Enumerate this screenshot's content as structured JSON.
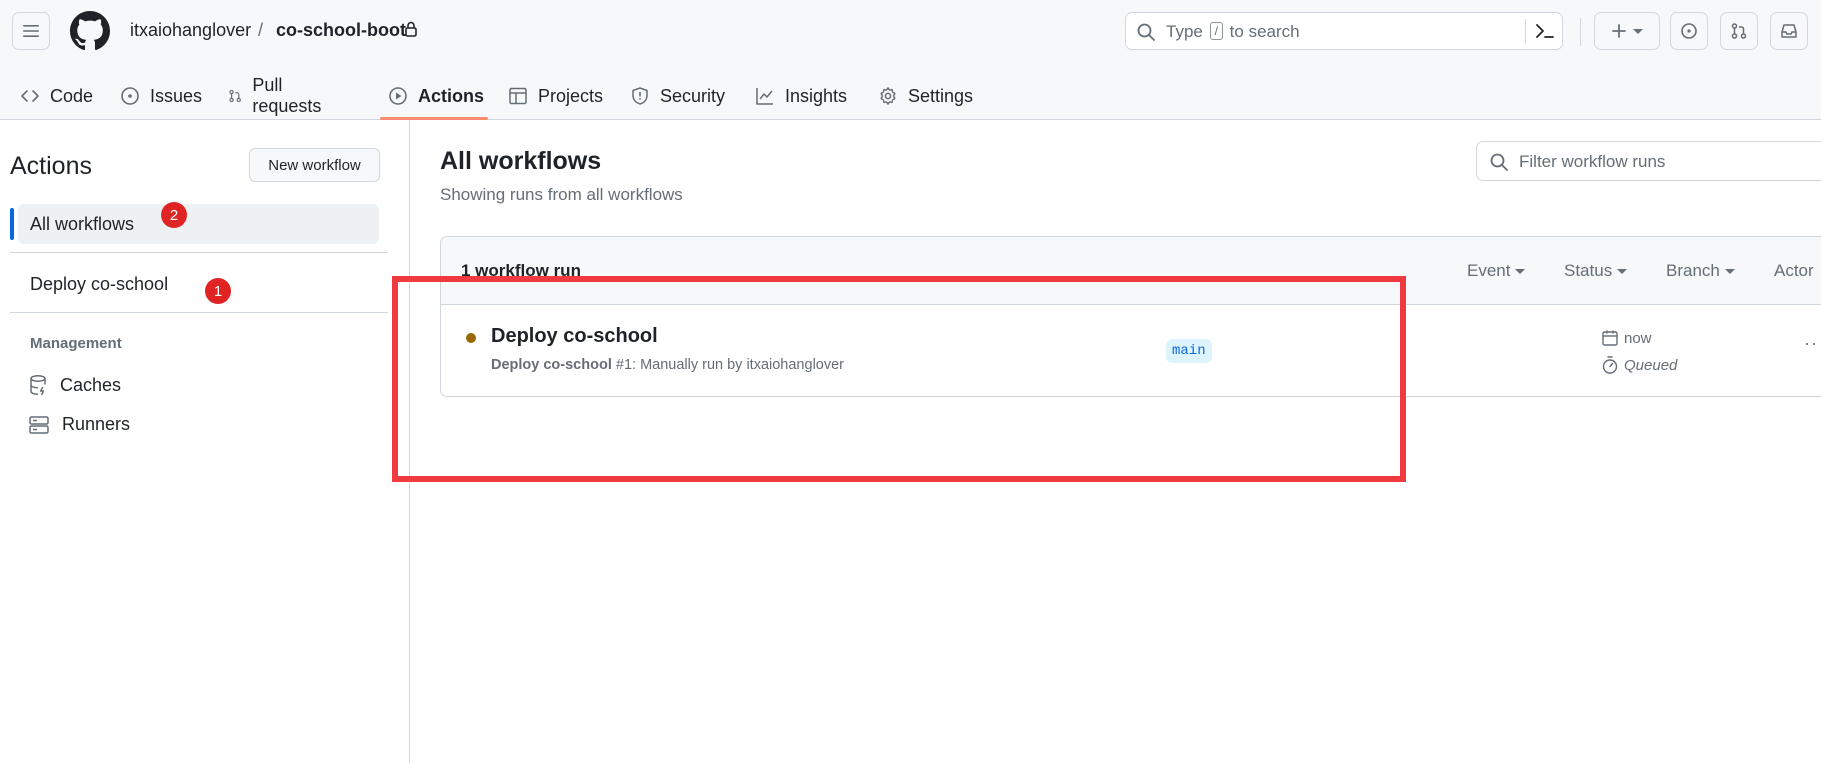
{
  "header": {
    "owner": "itxaiohanglover",
    "separator": "/",
    "repo": "co-school-boot",
    "search_prefix": "Type",
    "search_key": "/",
    "search_suffix": "to search",
    "icons": [
      "hamburger-icon",
      "github-logo",
      "lock-icon",
      "search-icon",
      "command-palette-icon",
      "plus-icon",
      "issue-icon",
      "pull-request-icon",
      "inbox-icon"
    ]
  },
  "nav": {
    "tabs": [
      {
        "label": "Code",
        "icon": "code-icon"
      },
      {
        "label": "Issues",
        "icon": "issue-icon"
      },
      {
        "label": "Pull requests",
        "icon": "pull-request-icon"
      },
      {
        "label": "Actions",
        "icon": "play-icon",
        "active": true
      },
      {
        "label": "Projects",
        "icon": "table-icon"
      },
      {
        "label": "Security",
        "icon": "shield-icon"
      },
      {
        "label": "Insights",
        "icon": "graph-icon"
      },
      {
        "label": "Settings",
        "icon": "gear-icon"
      }
    ]
  },
  "sidebar": {
    "title": "Actions",
    "new_workflow": "New workflow",
    "all_workflows": "All workflows",
    "workflow": "Deploy co-school",
    "management_label": "Management",
    "caches": "Caches",
    "runners": "Runners",
    "badge_all": "2",
    "badge_deploy": "1"
  },
  "main": {
    "title": "All workflows",
    "subtitle": "Showing runs from all workflows",
    "filter_placeholder": "Filter workflow runs",
    "run_count": "1 workflow run",
    "filters": {
      "event": "Event",
      "status": "Status",
      "branch": "Branch",
      "actor": "Actor"
    },
    "run": {
      "title": "Deploy co-school",
      "meta_workflow": "Deploy co-school",
      "meta_rest": " #1: Manually run by itxaiohanglover",
      "branch": "main",
      "time": "now",
      "status": "Queued",
      "status_color": "#9a6700"
    }
  },
  "colors": {
    "accent": "#0969da",
    "tab_underline": "#fd8c73",
    "annotation": "#ef3a3f",
    "badge": "#e02424"
  }
}
